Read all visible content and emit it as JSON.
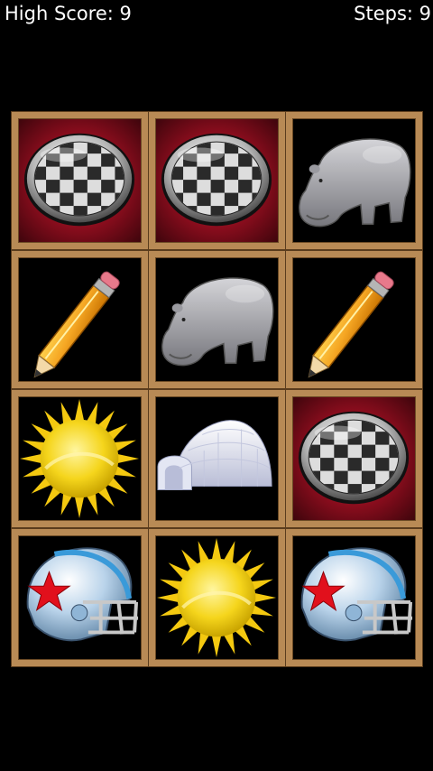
{
  "hud": {
    "high_score_label": "High Score: 9",
    "steps_label": "Steps: 9"
  },
  "board": {
    "rows": 4,
    "cols": 3,
    "cells": [
      {
        "icon": "checker-disc-icon",
        "state": "matched"
      },
      {
        "icon": "checker-disc-icon",
        "state": "matched"
      },
      {
        "icon": "hippo-icon",
        "state": "revealed"
      },
      {
        "icon": "pencil-icon",
        "state": "revealed"
      },
      {
        "icon": "hippo-icon",
        "state": "revealed"
      },
      {
        "icon": "pencil-icon",
        "state": "revealed"
      },
      {
        "icon": "sun-icon",
        "state": "revealed"
      },
      {
        "icon": "igloo-icon",
        "state": "revealed"
      },
      {
        "icon": "checker-disc-icon",
        "state": "matched"
      },
      {
        "icon": "helmet-icon",
        "state": "revealed"
      },
      {
        "icon": "sun-icon",
        "state": "revealed"
      },
      {
        "icon": "helmet-icon",
        "state": "revealed"
      }
    ]
  },
  "colors": {
    "matched_bg": "#8a0d1d",
    "frame": "#b88a55",
    "background": "#000000"
  }
}
